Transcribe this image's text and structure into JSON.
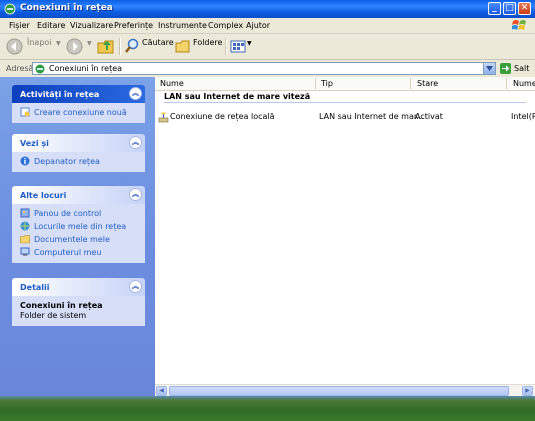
{
  "window": {
    "title": "Conexiuni în rețea"
  },
  "menu": [
    "Fișier",
    "Editare",
    "Vizualizare",
    "Preferințe",
    "Instrumente",
    "Complex",
    "Ajutor"
  ],
  "toolbar": {
    "back_label": "Înapoi",
    "search_label": "Căutare",
    "folders_label": "Foldere"
  },
  "address": {
    "label": "Adresă",
    "value": "Conexiuni în rețea",
    "go_label": "Salt"
  },
  "panels": {
    "tasks": {
      "title": "Activități în rețea",
      "items": [
        "Creare conexiune nouă"
      ]
    },
    "see_also": {
      "title": "Vezi și",
      "items": [
        "Depanator rețea"
      ]
    },
    "other_places": {
      "title": "Alte locuri",
      "items": [
        "Panou de control",
        "Locurile mele din rețea",
        "Documentele mele",
        "Computerul meu"
      ]
    },
    "details": {
      "title": "Detalii",
      "name": "Conexiuni în rețea",
      "type": "Folder de sistem"
    }
  },
  "list": {
    "columns": [
      "Nume",
      "Tip",
      "Stare",
      "Nume"
    ],
    "group": "LAN sau Internet de mare viteză",
    "rows": [
      {
        "name": "Conexiune de rețea locală",
        "type": "LAN sau Internet de mar...",
        "status": "Activat",
        "device": "Intel(R"
      }
    ]
  },
  "colors": {
    "accent": "#215dc6",
    "title_bar": "#0a5fe6",
    "task_pane": "#6c8ee0"
  }
}
